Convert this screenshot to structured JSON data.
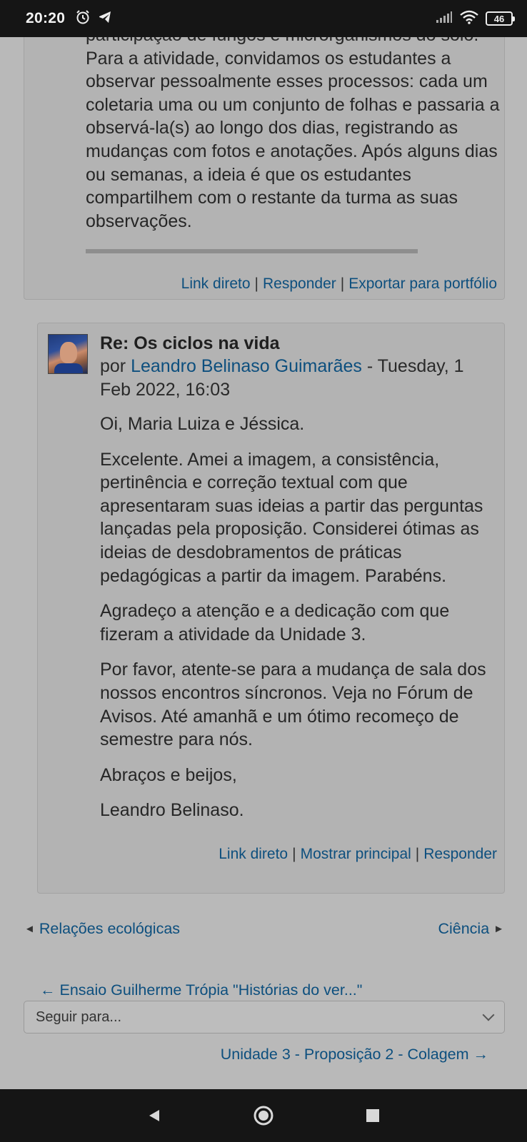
{
  "status_bar": {
    "time": "20:20",
    "battery": "46"
  },
  "parent_post": {
    "body": "participação de fungos e microrganismos do solo. Para a atividade, convidamos os estudantes a observar pessoalmente esses processos: cada um coletaria uma ou um conjunto de folhas e passaria a observá-la(s) ao longo dos dias, registrando as mudanças com fotos e anotações. Após alguns dias ou semanas, a ideia é que os estudantes compartilhem com o restante da turma as suas observações.",
    "commands": {
      "permalink": "Link direto",
      "reply": "Responder",
      "export": "Exportar para portfólio"
    }
  },
  "reply_post": {
    "subject": "Re: Os ciclos na vida",
    "by": "por",
    "author": "Leandro Belinaso Guimarães",
    "date": " - Tuesday, 1 Feb 2022, 16:03",
    "paragraphs": [
      "Oi, Maria Luiza e Jéssica.",
      "Excelente. Amei a imagem, a consistência, pertinência e correção textual com que apresentaram suas ideias a partir das perguntas lançadas pela proposição. Considerei ótimas as ideias de desdobramentos de práticas pedagógicas a partir da imagem. Parabéns.",
      "Agradeço a atenção e a dedicação com que fizeram a atividade da Unidade 3.",
      "Por favor, atente-se para a mudança de sala dos nossos encontros síncronos. Veja no Fórum de Avisos. Até amanhã e um ótimo recomeço de semestre para nós.",
      "Abraços e beijos,",
      "Leandro Belinaso."
    ],
    "commands": {
      "permalink": "Link direto",
      "show_parent": "Mostrar principal",
      "reply": "Responder"
    }
  },
  "discussion_nav": {
    "prev_label": "Relações ecológicas",
    "next_label": "Ciência"
  },
  "activity_nav": {
    "prev_label": "← Ensaio Guilherme Trópia \"Histórias do ver...\"",
    "jump_placeholder": "Seguir para...",
    "next_label": "Unidade 3 - Proposição 2 - Colagem →"
  },
  "colors": {
    "background": "#b9b9b9",
    "link": "#0d4f7e",
    "system_bar": "#151515"
  }
}
